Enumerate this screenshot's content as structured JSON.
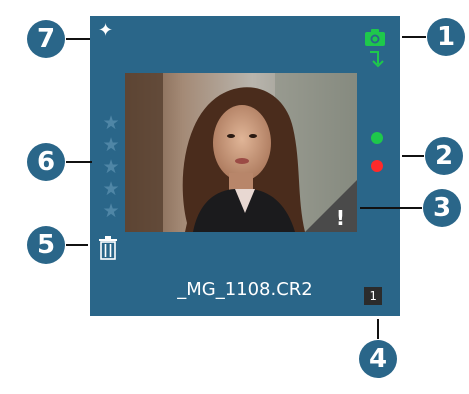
{
  "callouts": [
    "1",
    "2",
    "3",
    "4",
    "5",
    "6",
    "7"
  ],
  "thumbnail": {
    "filename": "_MG_1108.CR2",
    "badge": "1",
    "warning_mark": "!",
    "sparkle": "✦",
    "rating": {
      "stars_total": 5,
      "stars_filled": 0,
      "star_glyph": "★"
    },
    "flags": [
      {
        "name": "green",
        "color": "#1ec84b"
      },
      {
        "name": "red",
        "color": "#ff2a2a"
      }
    ],
    "icons": {
      "camera": "camera-icon",
      "import": "import-arrow-icon",
      "trash": "trash-icon",
      "sparkle": "sparkle-icon",
      "warning": "warning-icon"
    }
  },
  "colors": {
    "card": "#2a6689",
    "callout": "#2a6689",
    "green_indicator": "#1ec84b",
    "red_indicator": "#ff2a2a",
    "star_empty": "#4f86a6"
  }
}
